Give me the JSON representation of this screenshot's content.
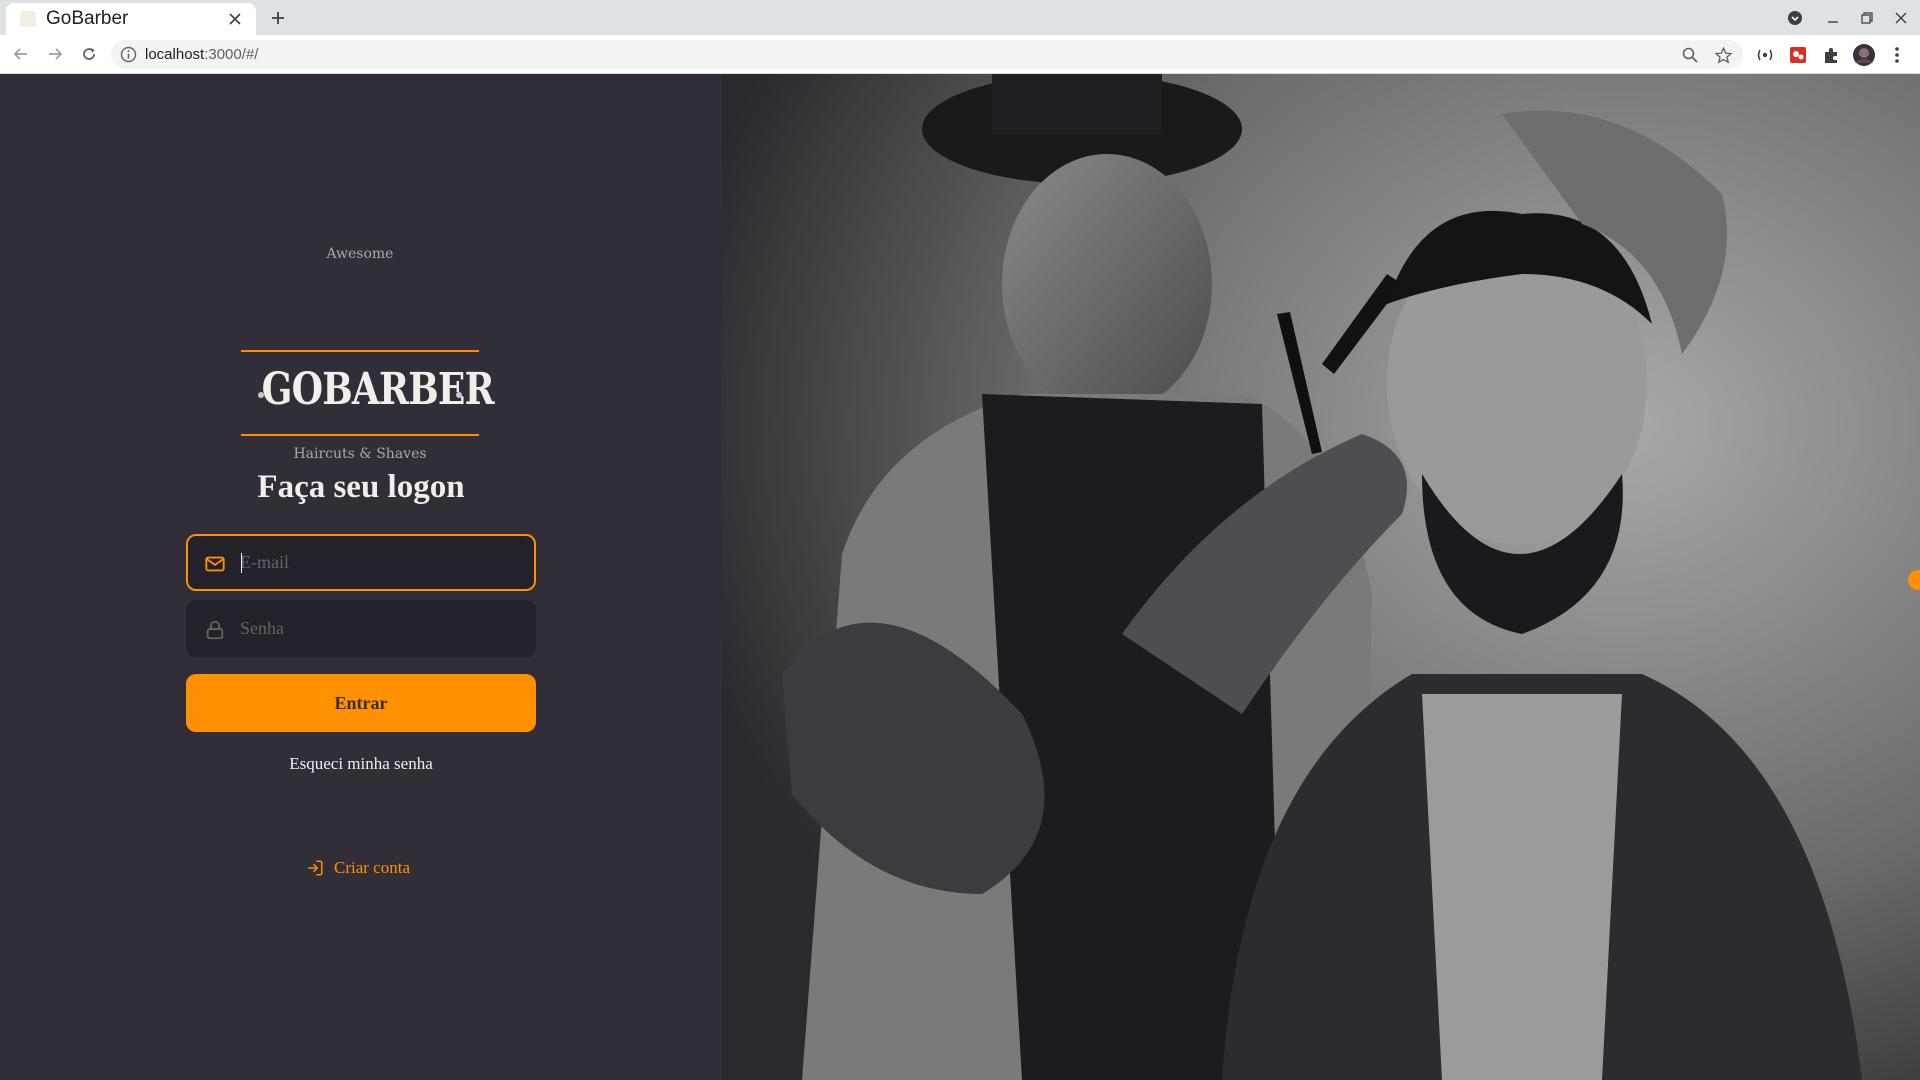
{
  "browser": {
    "tab_title": "GoBarber",
    "url_host": "localhost",
    "url_rest": ":3000/#/"
  },
  "logo": {
    "top_text": "Awesome",
    "brand": "GOBARBER",
    "bottom_text": "Haircuts & Shaves"
  },
  "form": {
    "heading": "Faça seu logon",
    "email_placeholder": "E-mail",
    "password_placeholder": "Senha",
    "submit_label": "Entrar",
    "forgot_label": "Esqueci minha senha"
  },
  "signup": {
    "label": "Criar conta"
  },
  "colors": {
    "background": "#312e38",
    "accent": "#ff9000",
    "input_bg": "#232129",
    "text": "#f4ede8"
  },
  "icons": {
    "email": "mail-icon",
    "password": "lock-icon",
    "signup": "log-in-icon"
  }
}
